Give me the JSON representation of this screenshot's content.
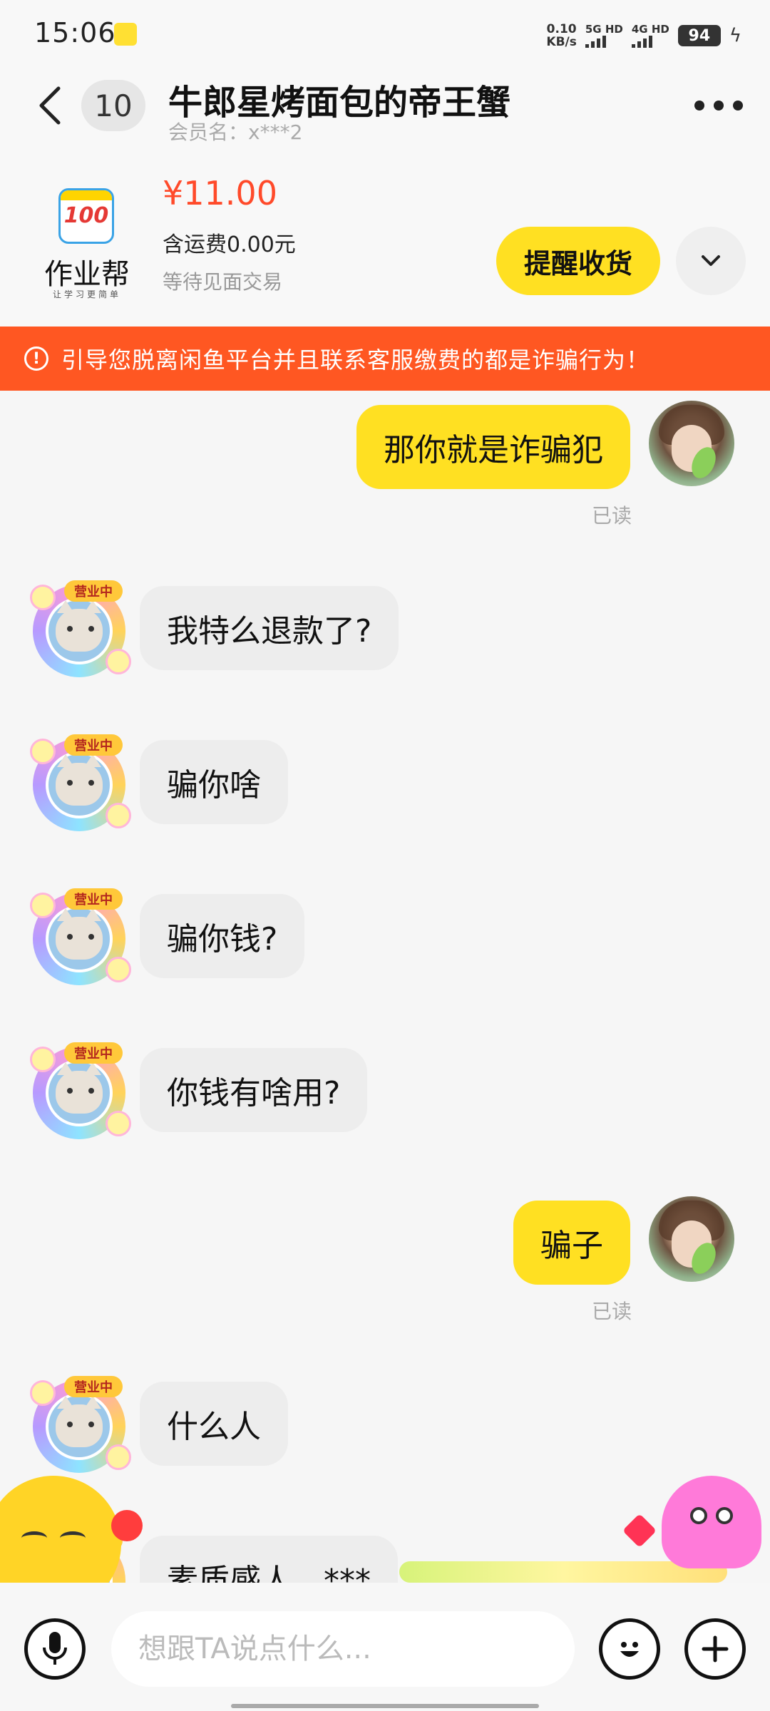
{
  "status_bar": {
    "time": "15:06",
    "net_speed_value": "0.10",
    "net_speed_unit": "KB/s",
    "sim1_label": "5G HD",
    "sim2_label": "4G HD",
    "battery": "94"
  },
  "header": {
    "back_icon": "chevron-left-icon",
    "unread_count": "10",
    "title": "牛郎星烤面包的帝王蟹",
    "member_name": "会员名：x***2",
    "more_icon": "more-horizontal-icon"
  },
  "product": {
    "logo_number": "100",
    "logo_text": "作业帮",
    "logo_subtext": "让学习更简单",
    "price": "¥11.00",
    "shipping": "含运费0.00元",
    "status": "等待见面交易",
    "remind_button": "提醒收货",
    "expand_icon": "chevron-down-icon"
  },
  "warning": {
    "icon": "exclamation-circle-icon",
    "text": "引导您脱离闲鱼平台并且联系客服缴费的都是诈骗行为！"
  },
  "messages": [
    {
      "from": "me",
      "text": "那你就是诈骗犯",
      "read": "已读"
    },
    {
      "from": "them",
      "text": "我特么退款了?"
    },
    {
      "from": "them",
      "text": "骗你啥"
    },
    {
      "from": "them",
      "text": "骗你钱?"
    },
    {
      "from": "them",
      "text": "你钱有啥用?"
    },
    {
      "from": "me",
      "text": "骗子",
      "read": "已读"
    },
    {
      "from": "them",
      "text": "什么人"
    },
    {
      "from": "them",
      "text": "素质感人，***"
    }
  ],
  "avatar_tag": "营业中",
  "input_bar": {
    "placeholder": "想跟TA说点什么...",
    "mic_icon": "microphone-icon",
    "emoji_icon": "smiley-icon",
    "plus_icon": "plus-icon"
  },
  "colors": {
    "accent_yellow": "#ffe022",
    "warning_orange": "#ff5722",
    "price_red": "#ff4a2a"
  }
}
